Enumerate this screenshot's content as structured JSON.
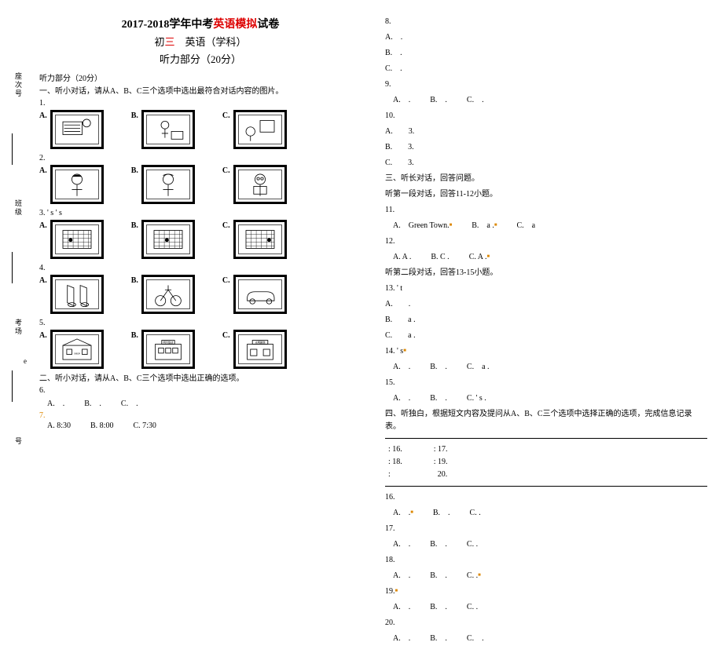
{
  "sidebar": {
    "labels": [
      "座次号",
      "班级",
      "考场",
      "号"
    ]
  },
  "header": {
    "line1_pre": "2017-2018学年中考",
    "line1_red": "英语模拟",
    "line1_post": "试卷",
    "line2_pre": "初",
    "line2_red": "三",
    "line2_post": "　英语（学科）",
    "line3": "听力部分（20分）"
  },
  "left": {
    "listening_header": "听力部分（20分）",
    "part1_instr": "一、听小对话，请从A、B、C三个选项中选出最符合对话内容的图片。",
    "q1": "1.",
    "q2": "2.",
    "q3": "3.  ' s ' s",
    "q4": "4.",
    "q5": "5.",
    "exam_label_e": "e",
    "part2_instr": "二、听小对话，请从A、B、C三个选项中选出正确的选项。",
    "q6": "6.",
    "q6a": "A.　.",
    "q6b": "B.　.",
    "q6c": "C.　.",
    "q7": "7.",
    "q7a": "A. 8:30",
    "q7b": "B. 8:00",
    "q7c": "C. 7:30",
    "opt_a": "A.",
    "opt_b": "B.",
    "opt_c": "C."
  },
  "right": {
    "q8": "8.",
    "q8a": "A.　.",
    "q8b": "B.　.",
    "q8c": "C.　.",
    "q9": "9.",
    "q9a": "A.　.",
    "q9b": "B.　.",
    "q9c": "C.　.",
    "q10": "10.",
    "q10a": "A.　　3.",
    "q10b": "B.　　3.",
    "q10c": "C.　　3.",
    "part3_header": "三、听长对话，回答问题。",
    "part3_sub1": "听第一段对话，回答11-12小题。",
    "q11": "11.",
    "q11a": "A.　Green Town.",
    "q11b": "B.　a .",
    "q11c": "C.　a",
    "q12": "12.",
    "q12a": "A. A .",
    "q12b": "B. C .",
    "q12c": "C. A .",
    "part3_sub2": "听第二段对话，回答13-15小题。",
    "q13": "13.  ' t",
    "q13a": "A.　　.",
    "q13b": "B.　　a .",
    "q13c": "C.　　a .",
    "q14": "14.  ' s",
    "q14a": "A.　.",
    "q14b": "B.　.",
    "q14c": "C.　a .",
    "q15": "15.",
    "q15a": "A.　.",
    "q15b": "B.　.",
    "q15c": "C.  ' s .",
    "part4_header": "四、听独白，根据短文内容及提问从A、B、C三个选项中选择正确的选项，完成信息记录表。",
    "table_r1": ": 16.　　　　: 17.",
    "table_r2": ": 18.　　　　: 19.",
    "table_r3": ":　　　　　　20.",
    "q16": "16.",
    "q16a": "A.　.",
    "q16b": "B.　.",
    "q16c": "C. .",
    "q17": "17.",
    "q17a": "A.　.",
    "q17b": "B.　.",
    "q17c": "C. .",
    "q18": "18.",
    "q18a": "A.　.",
    "q18b": "B.　.",
    "q18c": "C. .",
    "q19": "19.",
    "q19a": "A.　.",
    "q19b": "B.　.",
    "q19c": "C. .",
    "q20": "20.",
    "q20a": "A.　.",
    "q20b": "B.　.",
    "q20c": "C.　."
  }
}
